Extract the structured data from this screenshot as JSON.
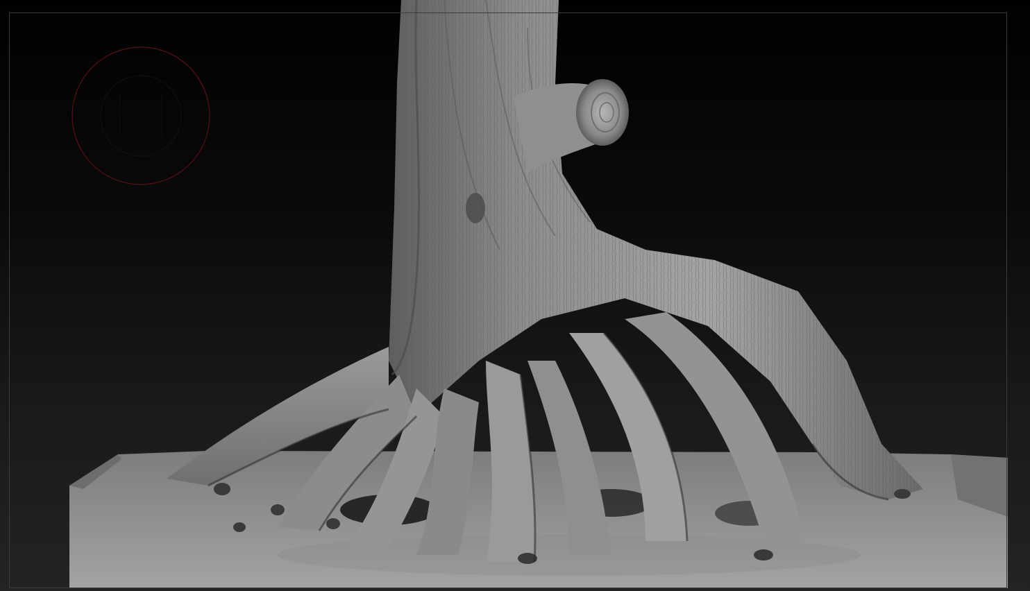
{
  "app": {
    "canvas_label": "",
    "document_name": ""
  },
  "viewport": {
    "background_top": "#010101",
    "background_bottom": "#232323",
    "frame_color": "#3c3c3c",
    "material_color": "#9a9a9a",
    "material_shadow": "#2a2a2a"
  },
  "gizmo": {
    "icon": "navigation-circle-icon",
    "color": "#5a0f18"
  },
  "model": {
    "icon": "tree-roots-sculpt"
  }
}
